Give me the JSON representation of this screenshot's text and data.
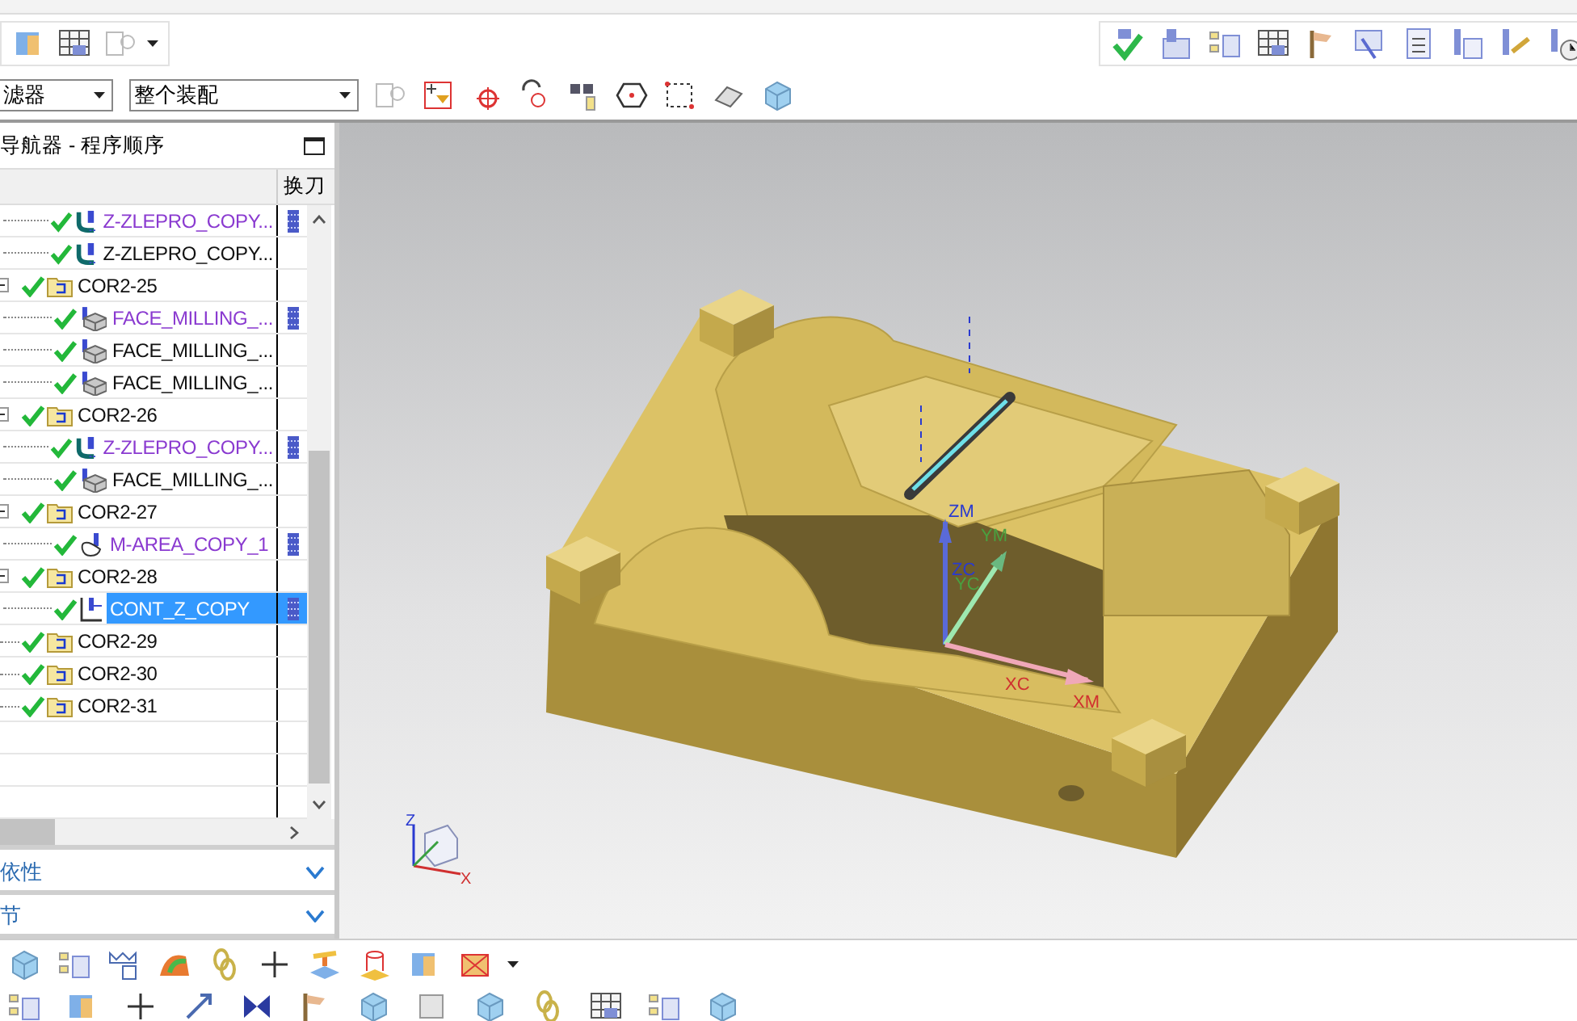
{
  "filters": {
    "type_filter": "滤器",
    "scope_filter": "整个装配"
  },
  "navigator": {
    "title": "导航器 - 程序顺序",
    "tool_change_header": "换刀",
    "continued_children": [
      {
        "name": "Z-ZLEPRO_COPY...",
        "kind": "zlevel",
        "modified": true,
        "tool_change": true,
        "selected": false
      },
      {
        "name": "Z-ZLEPRO_COPY...",
        "kind": "zlevel",
        "modified": false,
        "tool_change": false,
        "selected": false
      }
    ],
    "groups": [
      {
        "name": "COR2-25",
        "expanded": true,
        "selected": false,
        "children": [
          {
            "name": "FACE_MILLING_...",
            "kind": "face_milling",
            "modified": true,
            "tool_change": true,
            "selected": false
          },
          {
            "name": "FACE_MILLING_...",
            "kind": "face_milling",
            "modified": false,
            "tool_change": false,
            "selected": false
          },
          {
            "name": "FACE_MILLING_...",
            "kind": "face_milling",
            "modified": false,
            "tool_change": false,
            "selected": false
          }
        ]
      },
      {
        "name": "COR2-26",
        "expanded": true,
        "selected": false,
        "children": [
          {
            "name": "Z-ZLEPRO_COPY...",
            "kind": "zlevel",
            "modified": true,
            "tool_change": true,
            "selected": false
          },
          {
            "name": "FACE_MILLING_...",
            "kind": "face_milling",
            "modified": false,
            "tool_change": false,
            "selected": false
          }
        ]
      },
      {
        "name": "COR2-27",
        "expanded": true,
        "selected": false,
        "children": [
          {
            "name": "M-AREA_COPY_1",
            "kind": "area",
            "modified": true,
            "tool_change": true,
            "selected": false
          }
        ]
      },
      {
        "name": "COR2-28",
        "expanded": true,
        "selected": false,
        "children": [
          {
            "name": "CONT_Z_COPY",
            "kind": "contour",
            "modified": false,
            "tool_change": true,
            "selected": true
          }
        ]
      },
      {
        "name": "COR2-29",
        "expanded": false,
        "selected": false
      },
      {
        "name": "COR2-30",
        "expanded": false,
        "selected": false
      },
      {
        "name": "COR2-31",
        "expanded": false,
        "selected": false
      }
    ],
    "sections": [
      {
        "label": "依性",
        "expanded": false
      },
      {
        "label": "节",
        "expanded": false
      }
    ]
  },
  "viewport": {
    "wcs_labels": {
      "zm": "ZM",
      "ym": "YM",
      "zc": "ZC",
      "yc": "YC",
      "xc": "XC",
      "xm": "XM"
    },
    "triad_labels": {
      "z": "Z",
      "x": "X"
    }
  }
}
